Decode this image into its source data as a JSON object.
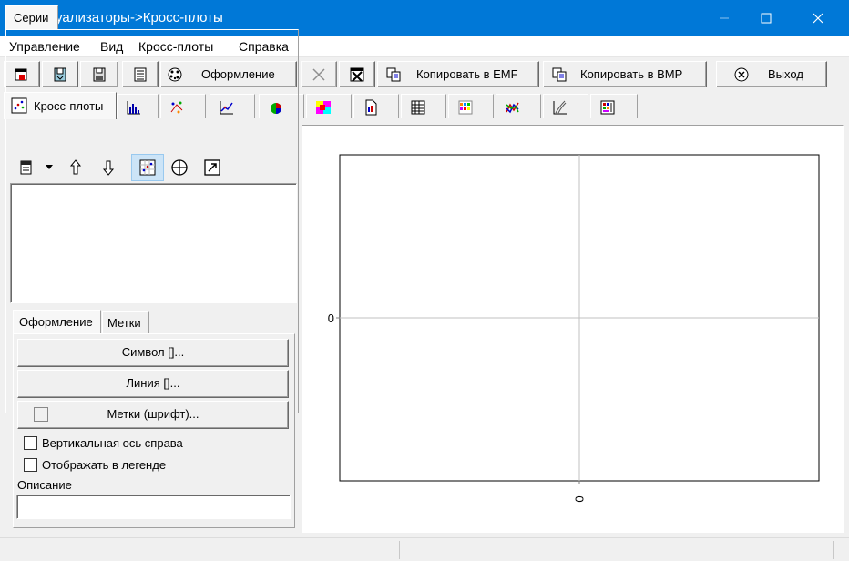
{
  "window": {
    "title": "Визуализаторы->Кросс-плоты",
    "icon": "app-logo-icon"
  },
  "menu": {
    "items": [
      "Управление",
      "Вид",
      "Кросс-плоты",
      "Справка"
    ]
  },
  "toolbar": {
    "design_label": "Оформление",
    "copy_emf_label": "Копировать в EMF",
    "copy_bmp_label": "Копировать в BMP",
    "exit_label": "Выход"
  },
  "visualizer_tabs": {
    "active_label": "Кросс-плоты"
  },
  "left_panel": {
    "series_tab": "Серии",
    "inner_tabs": [
      "Оформление",
      "Метки"
    ],
    "symbol_button": "Символ []...",
    "line_button": "Линия []...",
    "marks_font_button": "Метки (шрифт)...",
    "checkbox_right_axis": "Вертикальная ось справа",
    "checkbox_legend": "Отображать в легенде",
    "description_label": "Описание",
    "description_value": ""
  },
  "chart_data": {
    "type": "scatter",
    "series": [],
    "x_tick_labels": [
      "0"
    ],
    "y_tick_labels": [
      "0"
    ],
    "grid": true,
    "title": "",
    "xlabel": "",
    "ylabel": ""
  },
  "colors": {
    "titlebar": "#0078d7",
    "face": "#f0f0f0",
    "plot_bg": "#ffffff",
    "gridline": "#c0c0c0"
  }
}
